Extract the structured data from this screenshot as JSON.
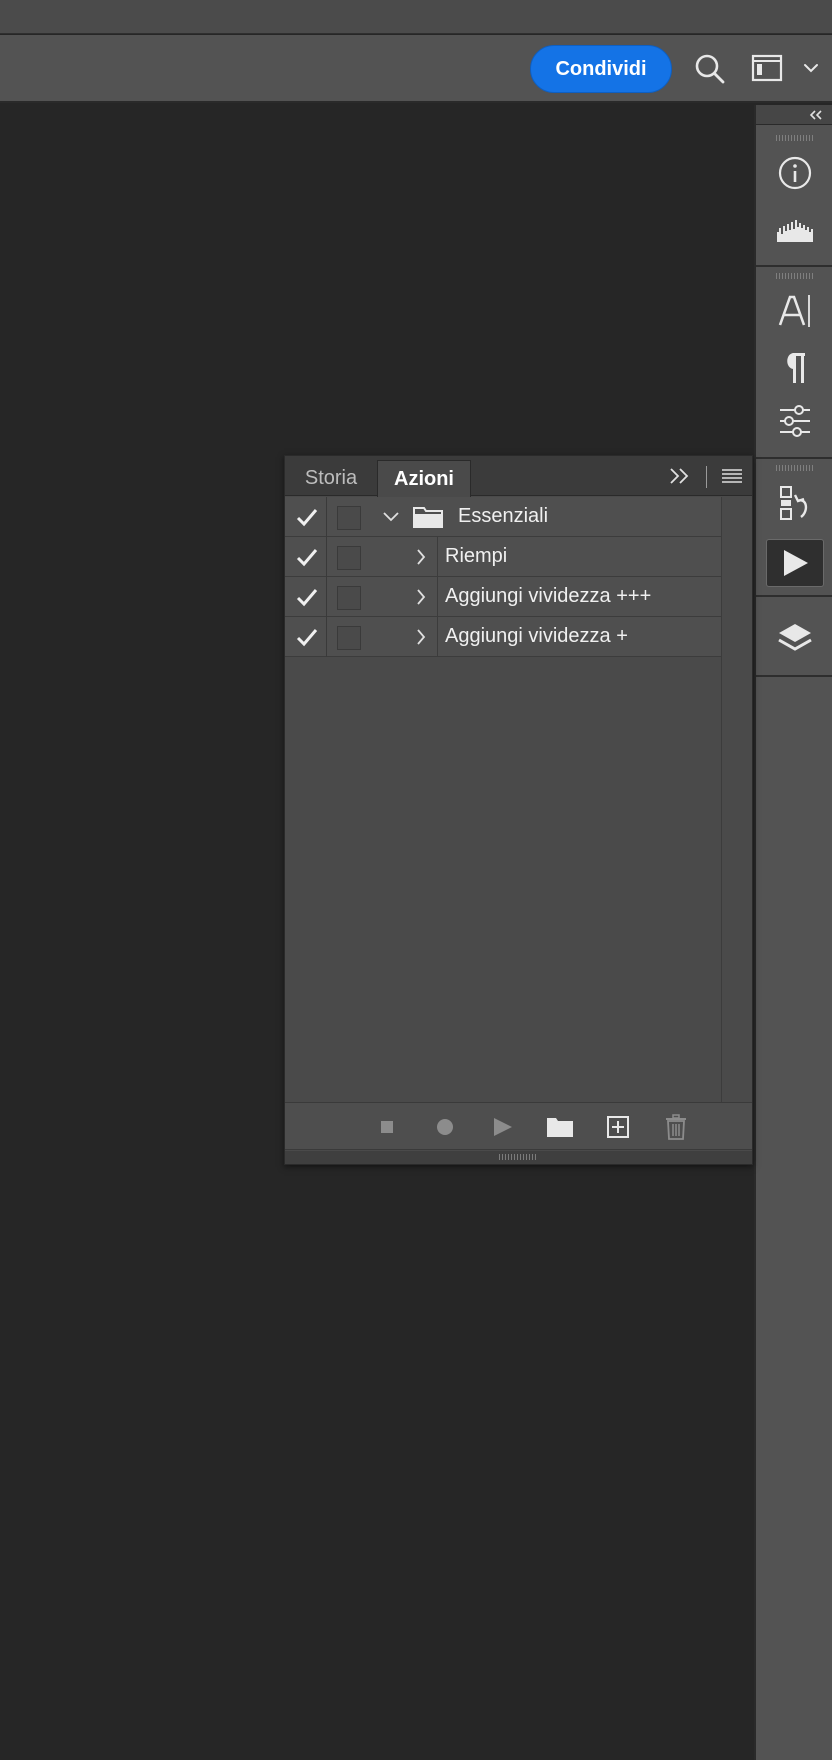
{
  "toolbar": {
    "share_label": "Condividi"
  },
  "panel": {
    "tabs": [
      {
        "label": "Storia",
        "active": false
      },
      {
        "label": "Azioni",
        "active": true
      }
    ],
    "actions": [
      {
        "label": "Essenziali",
        "type": "set",
        "expanded": true,
        "checked": true
      },
      {
        "label": "Riempi",
        "type": "action",
        "expanded": false,
        "checked": true
      },
      {
        "label": "Aggiungi vividezza +++",
        "type": "action",
        "expanded": false,
        "checked": true
      },
      {
        "label": "Aggiungi vividezza +",
        "type": "action",
        "expanded": false,
        "checked": true
      }
    ],
    "footer_icons": [
      "stop-icon",
      "record-icon",
      "play-icon",
      "folder-icon",
      "new-action-icon",
      "trash-icon"
    ]
  },
  "dock": {
    "icons": [
      "info-icon",
      "histogram-icon",
      "character-icon",
      "paragraph-icon",
      "adjustments-icon",
      "history-icon",
      "actions-icon",
      "layers-icon"
    ]
  },
  "colors": {
    "accent": "#1473e6",
    "panel_bg": "#4a4a4a",
    "canvas_bg": "#262626"
  }
}
